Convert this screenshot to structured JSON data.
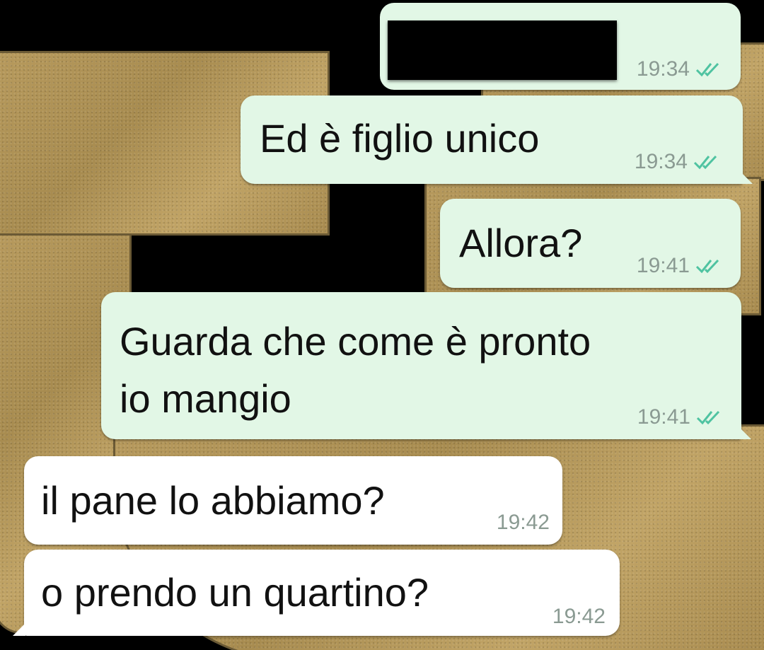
{
  "messages": [
    {
      "id": "m1",
      "direction": "outgoing",
      "text": "",
      "redacted": true,
      "time": "19:34",
      "status": "read-double-check-icon"
    },
    {
      "id": "m2",
      "direction": "outgoing",
      "text": "Ed è figlio unico",
      "time": "19:34",
      "status": "read-double-check-icon"
    },
    {
      "id": "m3",
      "direction": "outgoing",
      "text": "Allora?",
      "time": "19:41",
      "status": "read-double-check-icon"
    },
    {
      "id": "m4",
      "direction": "outgoing",
      "lines": [
        "Guarda che come è pronto",
        "io mangio"
      ],
      "time": "19:41",
      "status": "read-double-check-icon"
    },
    {
      "id": "m5",
      "direction": "incoming",
      "text": "il pane lo abbiamo?",
      "time": "19:42"
    },
    {
      "id": "m6",
      "direction": "incoming",
      "text": "o prendo un quartino?",
      "time": "19:42"
    }
  ],
  "colors": {
    "outgoing_bubble": "#e2f7e6",
    "incoming_bubble": "#ffffff",
    "read_check": "#4fc3a1",
    "wallpaper_gold": "#b79a5d",
    "wallpaper_black": "#000000"
  }
}
